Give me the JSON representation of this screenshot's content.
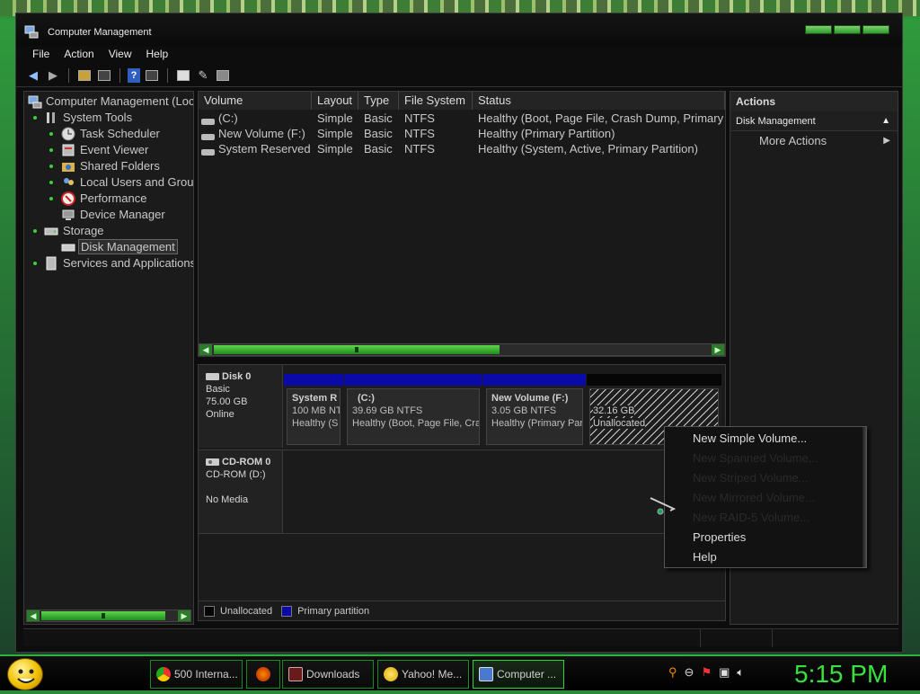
{
  "window": {
    "title": "Computer Management"
  },
  "menu": [
    "File",
    "Action",
    "View",
    "Help"
  ],
  "tree": {
    "root": "Computer Management (Loc",
    "items": [
      {
        "label": "System Tools",
        "level": 1,
        "icon": "tools-icon"
      },
      {
        "label": "Task Scheduler",
        "level": 2,
        "icon": "clock-icon"
      },
      {
        "label": "Event Viewer",
        "level": 2,
        "icon": "event-viewer-icon"
      },
      {
        "label": "Shared Folders",
        "level": 2,
        "icon": "shared-folders-icon"
      },
      {
        "label": "Local Users and Grou",
        "level": 2,
        "icon": "users-icon"
      },
      {
        "label": "Performance",
        "level": 2,
        "icon": "performance-icon"
      },
      {
        "label": "Device Manager",
        "level": 2,
        "icon": "device-manager-icon"
      },
      {
        "label": "Storage",
        "level": 1,
        "icon": "storage-icon"
      },
      {
        "label": "Disk Management",
        "level": 2,
        "icon": "disk-management-icon",
        "selected": true
      },
      {
        "label": "Services and Applications",
        "level": 1,
        "icon": "services-icon"
      }
    ]
  },
  "volumes": {
    "headers": [
      "Volume",
      "Layout",
      "Type",
      "File System",
      "Status"
    ],
    "rows": [
      [
        "(C:)",
        "Simple",
        "Basic",
        "NTFS",
        "Healthy (Boot, Page File, Crash Dump, Primary"
      ],
      [
        "New Volume (F:)",
        "Simple",
        "Basic",
        "NTFS",
        "Healthy (Primary Partition)"
      ],
      [
        "System Reserved",
        "Simple",
        "Basic",
        "NTFS",
        "Healthy (System, Active, Primary Partition)"
      ]
    ]
  },
  "disks": {
    "disk0": {
      "name": "Disk 0",
      "type": "Basic",
      "size": "75.00 GB",
      "state": "Online",
      "partitions": [
        {
          "name": "System R",
          "size": "100 MB NT",
          "status": "Healthy (S"
        },
        {
          "name": "(C:)",
          "size": "39.69 GB NTFS",
          "status": "Healthy (Boot, Page File, Cra"
        },
        {
          "name": "New Volume  (F:)",
          "size": "3.05 GB NTFS",
          "status": "Healthy (Primary Part"
        },
        {
          "name": "",
          "size": "32.16 GB",
          "status": "Unallocated"
        }
      ]
    },
    "cdrom": {
      "name": "CD-ROM 0",
      "type": "CD-ROM (D:)",
      "state": "No Media"
    }
  },
  "legend": {
    "unallocated": "Unallocated",
    "primary": "Primary partition"
  },
  "actions": {
    "header": "Actions",
    "section": "Disk Management",
    "more": "More Actions"
  },
  "context_menu": {
    "items": [
      {
        "label": "New Simple Volume...",
        "enabled": true
      },
      {
        "label": "New Spanned Volume...",
        "enabled": false
      },
      {
        "label": "New Striped Volume...",
        "enabled": false
      },
      {
        "label": "New Mirrored Volume...",
        "enabled": false
      },
      {
        "label": "New RAID-5 Volume...",
        "enabled": false
      },
      {
        "label": "Properties",
        "enabled": true
      },
      {
        "label": "Help",
        "enabled": true
      }
    ]
  },
  "taskbar": {
    "tasks": [
      {
        "label": "500 Interna...",
        "icon": "chrome-icon",
        "color": "#e8b400"
      },
      {
        "label": "",
        "icon": "firefox-icon",
        "color": "#e06a10"
      },
      {
        "label": "Downloads",
        "icon": "downloads-icon",
        "color": "#8b2a2a"
      },
      {
        "label": "Yahoo! Me...",
        "icon": "yahoo-messenger-icon",
        "color": "#f2c200"
      },
      {
        "label": "Computer ...",
        "icon": "computer-management-icon",
        "color": "#3a6ad0"
      }
    ],
    "clock": "5:15 PM"
  },
  "colors": {
    "accent": "#39e13e",
    "primary_partition": "#0a0aa8"
  }
}
